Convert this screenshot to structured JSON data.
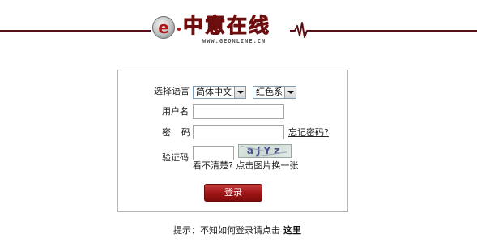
{
  "brand": {
    "icon_glyph": "e",
    "name": "中意在线",
    "url": "WWW.GEONLINE.CN"
  },
  "colors": {
    "brand_red": "#b01818",
    "header_line": "#5a0f14",
    "button_red": "#9e1414"
  },
  "form": {
    "language_label": "选择语言",
    "language_selected": "简体中文",
    "theme_selected": "红色系",
    "username_label": "用户名",
    "username_value": "",
    "password_label_1": "密",
    "password_label_2": "码",
    "password_value": "",
    "forgot_link": "忘记密码?",
    "captcha_label": "验证码",
    "captcha_value": "",
    "captcha_text": "aJYz",
    "captcha_hint": "看不清楚? 点击图片换一张",
    "login_button": "登录"
  },
  "footer": {
    "tip": "提示：不知如何登录请点击",
    "here_link": "这里"
  }
}
